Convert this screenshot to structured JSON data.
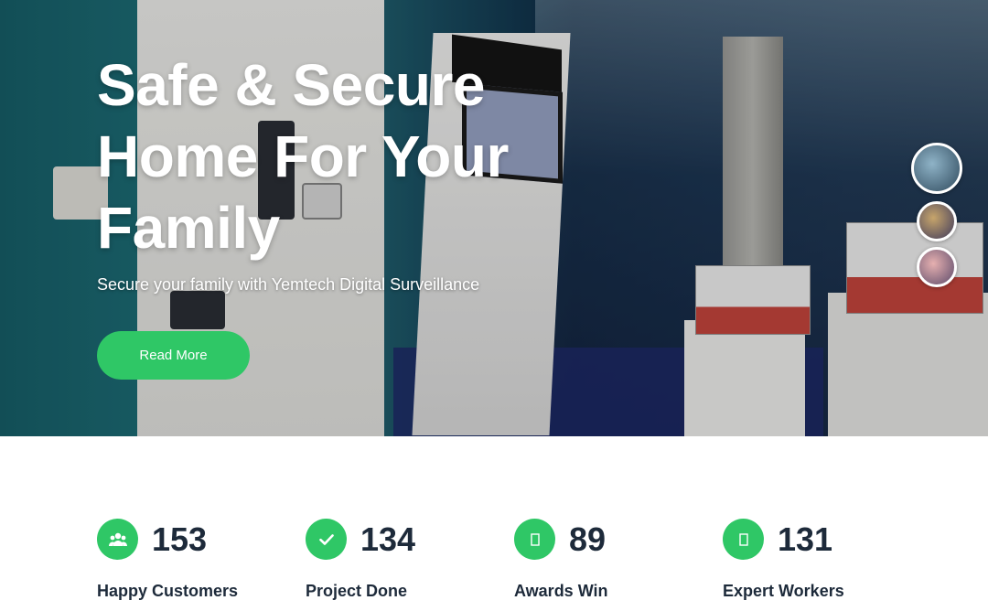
{
  "hero": {
    "title": "Safe & Secure Home For Your Family",
    "subtitle": "Secure your family with Yemtech Digital Surveillance",
    "read_more_label": "Read More"
  },
  "stats": [
    {
      "icon": "users-icon",
      "value": "153",
      "label": "Happy Customers"
    },
    {
      "icon": "check-icon",
      "value": "134",
      "label": "Project Done"
    },
    {
      "icon": "award-icon",
      "value": "89",
      "label": "Awards Win"
    },
    {
      "icon": "worker-icon",
      "value": "131",
      "label": "Expert Workers"
    }
  ],
  "colors": {
    "accent": "#2fc766",
    "text_dark": "#1d2a3a"
  }
}
